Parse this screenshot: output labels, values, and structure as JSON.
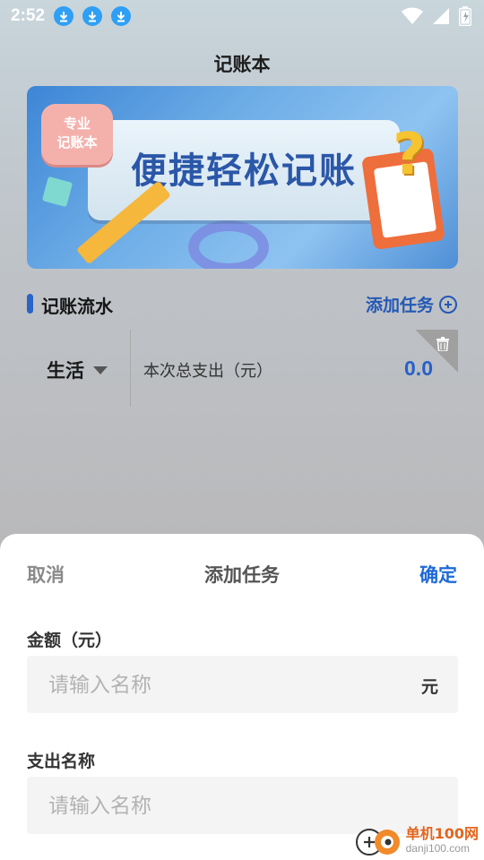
{
  "status_bar": {
    "time": "2:52",
    "notification_icons": [
      "download-icon",
      "download-icon",
      "download-icon"
    ],
    "system_icons": [
      "wifi-icon",
      "signal-icon",
      "battery-icon"
    ]
  },
  "app": {
    "title": "记账本",
    "banner": {
      "badge_line1": "专业",
      "badge_line2": "记账本",
      "headline": "便捷轻松记账"
    },
    "section": {
      "title": "记账流水",
      "add_task_label": "添加任务"
    },
    "record": {
      "category": "生活",
      "total_label": "本次总支出（元）",
      "total_value": "0.0"
    }
  },
  "sheet": {
    "cancel_label": "取消",
    "title": "添加任务",
    "confirm_label": "确定",
    "amount": {
      "label": "金额（元）",
      "placeholder": "请输入名称",
      "value": "",
      "unit": "元"
    },
    "expense_name": {
      "label": "支出名称",
      "placeholder": "请输入名称",
      "value": ""
    }
  },
  "watermark": {
    "name": "单机100网",
    "domain": "danji100.com"
  },
  "colors": {
    "accent": "#2561c9",
    "confirm": "#1f6ad6",
    "watermark": "#e2661e"
  }
}
